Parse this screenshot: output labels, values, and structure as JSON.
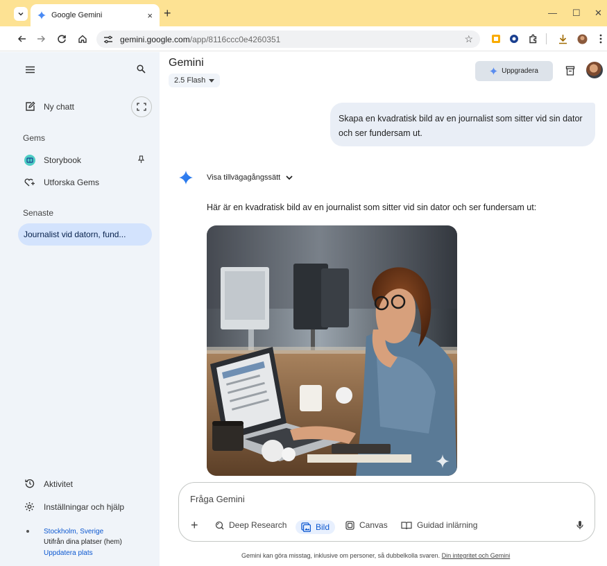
{
  "browser": {
    "tab_title": "Google Gemini",
    "tab_close": "×",
    "new_tab": "+",
    "url_host": "gemini.google.com",
    "url_path": "/app/8116ccc0e4260351",
    "minimize": "—",
    "maximize": "☐",
    "close": "✕"
  },
  "sidebar": {
    "new_chat": "Ny chatt",
    "gems_label": "Gems",
    "gems": [
      {
        "label": "Storybook"
      },
      {
        "label": "Utforska Gems"
      }
    ],
    "recent_label": "Senaste",
    "recent_items": [
      {
        "label": "Journalist vid datorn, fund..."
      }
    ],
    "activity": "Aktivitet",
    "settings": "Inställningar och hjälp",
    "location": {
      "place": "Stockholm, Sverige",
      "source": "Utifrån dina platser (hem)",
      "update": "Uppdatera plats"
    }
  },
  "header": {
    "title": "Gemini",
    "model": "2.5 Flash",
    "upgrade": "Uppgradera"
  },
  "chat": {
    "user_message": "Skapa en kvadratisk bild av en journalist som sitter vid sin dator och ser fundersam ut.",
    "show_process": "Visa tillvägagångssätt",
    "answer_text": "Här är en kvadratisk bild av en journalist som sitter vid sin dator och ser fundersam ut:"
  },
  "input": {
    "placeholder": "Fråga Gemini",
    "tools": [
      {
        "label": "Deep Research"
      },
      {
        "label": "Bild"
      },
      {
        "label": "Canvas"
      },
      {
        "label": "Guidad inlärning"
      }
    ]
  },
  "footer": {
    "disclaimer": "Gemini kan göra misstag, inklusive om personer, så dubbelkolla svaren.",
    "privacy_link": "Din integritet och Gemini"
  },
  "colors": {
    "tabbar": "#fde293",
    "sidebar": "#f0f4f9",
    "accent": "#0b57d0",
    "selected": "#d3e3fd"
  }
}
